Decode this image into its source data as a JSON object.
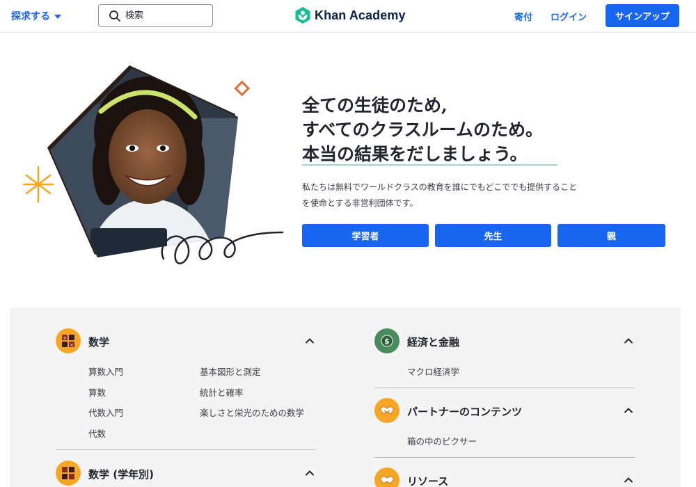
{
  "header": {
    "explore_label": "探求する",
    "search_placeholder": "検索",
    "logo_text": "Khan Academy",
    "donate_label": "寄付",
    "login_label": "ログイン",
    "signup_label": "サインアップ",
    "accent_color": "#1865f2",
    "logo_color": "#14bf96"
  },
  "hero": {
    "headline": [
      "全ての生徒のため,",
      "すべてのクラスルームのため。",
      "本当の結果をだしましょう。"
    ],
    "subtext": [
      "私たちは無料でワールドクラスの教育を誰にでもどこででも提供すること",
      "を使命とする非営利団体です。"
    ],
    "buttons": [
      "学習者",
      "先生",
      "親"
    ]
  },
  "subjects": {
    "math": {
      "title": "数学",
      "icon": "math-blocks-icon",
      "links_left": [
        "算数入門",
        "算数",
        "代数入門",
        "代数"
      ],
      "links_right": [
        "基本図形と測定",
        "統計と確率",
        "楽しさと栄光のための数学"
      ]
    },
    "math_grade": {
      "title": "数学 (学年別)",
      "icon": "math-blocks-icon"
    },
    "economics": {
      "title": "経済と金融",
      "icon": "money-icon",
      "links": [
        "マクロ経済学"
      ]
    },
    "partner": {
      "title": "パートナーのコンテンツ",
      "icon": "handshake-icon",
      "links": [
        "箱の中のピクサー"
      ]
    },
    "resources": {
      "title": "リソース",
      "icon": "handshake-icon"
    }
  }
}
